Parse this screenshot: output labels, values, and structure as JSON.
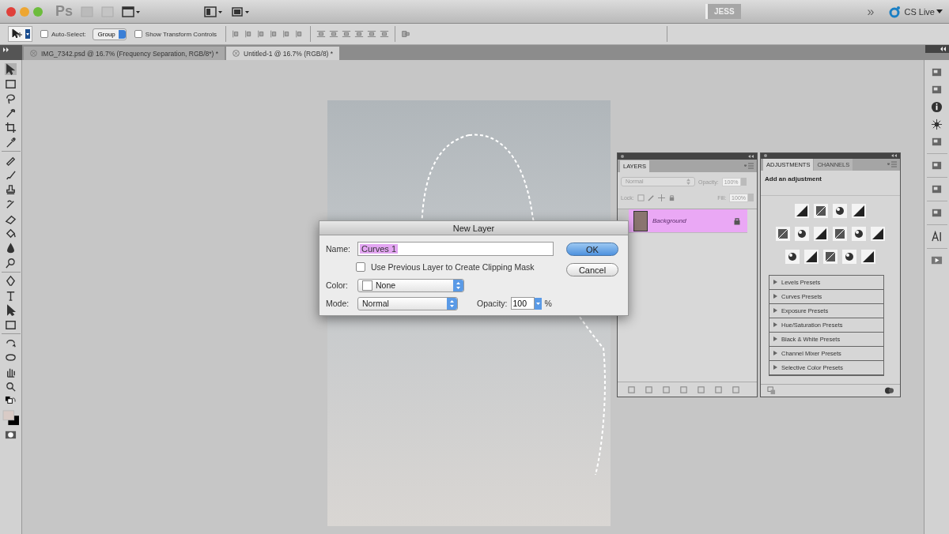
{
  "app_bar": {
    "logo": "Ps",
    "workspace": "JESS",
    "more": "»",
    "cs_live": "CS Live"
  },
  "options_bar": {
    "auto_select": {
      "label": "Auto-Select:",
      "checked": false
    },
    "auto_select_target": "Group",
    "show_transform": {
      "label": "Show Transform Controls",
      "checked": false
    }
  },
  "document_tabs": [
    {
      "label": "IMG_7342.psd @ 16.7% (Frequency Separation, RGB/8*) *",
      "selected": false
    },
    {
      "label": "Untitled-1 @ 16.7% (RGB/8) *",
      "selected": true
    }
  ],
  "dialog": {
    "title": "New Layer",
    "name_label": "Name:",
    "name_value": "Curves 1",
    "name_selected": true,
    "clipping": {
      "label": "Use Previous Layer to Create Clipping Mask",
      "checked": false
    },
    "color_label": "Color:",
    "color_value": "None",
    "mode_label": "Mode:",
    "mode_value": "Normal",
    "opacity_label": "Opacity:",
    "opacity_value": "100",
    "opacity_unit": "%",
    "buttons": [
      {
        "label": "OK",
        "default": true
      },
      {
        "label": "Cancel",
        "default": false
      }
    ]
  },
  "layers_panel": {
    "tab": "LAYERS",
    "blend_mode": "Normal",
    "opacity_label": "Opacity:",
    "opacity_value": "100%",
    "lock_label": "Lock:",
    "fill_label": "Fill:",
    "fill_value": "100%",
    "layers": [
      {
        "name": "Background",
        "selected": true,
        "locked": true
      }
    ]
  },
  "adjustments_panel": {
    "tabs": [
      {
        "label": "ADJUSTMENTS",
        "selected": true
      },
      {
        "label": "CHANNELS",
        "selected": false
      }
    ],
    "heading": "Add an adjustment",
    "presets": [
      {
        "label": "Levels Presets"
      },
      {
        "label": "Curves Presets"
      },
      {
        "label": "Exposure Presets"
      },
      {
        "label": "Hue/Saturation Presets"
      },
      {
        "label": "Black & White Presets"
      },
      {
        "label": "Channel Mixer Presets"
      },
      {
        "label": "Selective Color Presets"
      }
    ]
  }
}
